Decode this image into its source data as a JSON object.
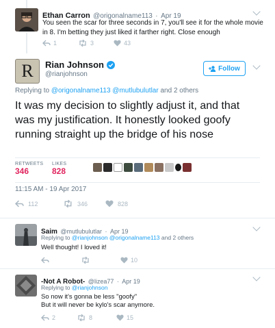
{
  "tweet1": {
    "name": "Ethan Carron",
    "handle": "@origonalname113",
    "time": "Apr 19",
    "text": "You seen the scar for three seconds in 7, you'll see it for the whole movie in 8. I'm betting they just liked it farther right. Close enough",
    "replies": "1",
    "retweets": "3",
    "likes": "43"
  },
  "main": {
    "avatar_letter": "R",
    "name": "Rian Johnson",
    "handle": "@rianjohnson",
    "follow_label": "Follow",
    "replying_prefix": "Replying to",
    "replying_to_1": "@origonalname113",
    "replying_to_2": "@mutlubulutlar",
    "replying_suffix": "and 2 others",
    "text": "It was my decision to slightly adjust it, and that was my justification. It honestly looked goofy running straight up the bridge of his nose",
    "retweets_label": "RETWEETS",
    "retweets_value": "346",
    "likes_label": "LIKES",
    "likes_value": "828",
    "timestamp": "11:15 AM - 19 Apr 2017",
    "replies": "112",
    "retweets": "346",
    "likes": "828",
    "verified_color": "#1da1f2"
  },
  "reply1": {
    "name": "Saim",
    "handle": "@mutlubulutlar",
    "time": "Apr 19",
    "replying_prefix": "Replying to",
    "replying_to": "@rianjohnson @origonalname113",
    "replying_suffix": "and 2 others",
    "text": "Well thought! I loved it!",
    "replies": "",
    "retweets": "",
    "likes": "10"
  },
  "reply2": {
    "name": "-Not A Robot-",
    "handle": "@lizea77",
    "time": "Apr 19",
    "replying_prefix": "Replying to",
    "replying_to": "@rianjohnson",
    "text_line1": "So now it's gonna be less \"goofy\"",
    "text_line2": "But it will never be kylo's scar anymore.",
    "replies": "2",
    "retweets": "8",
    "likes": "15"
  },
  "colors": {
    "accent": "#1da1f2",
    "like": "#e0245e",
    "muted": "#657786",
    "icon": "#aab8c2"
  }
}
